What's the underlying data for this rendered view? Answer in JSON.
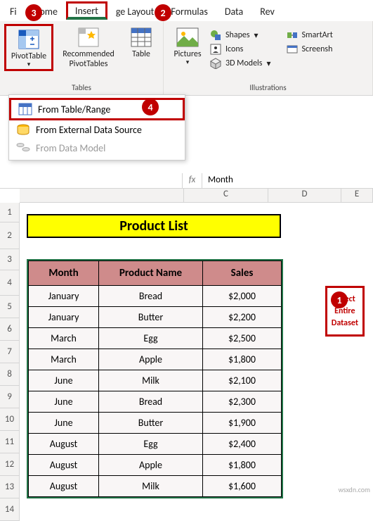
{
  "tabs": {
    "file": "Fi",
    "home": "Home",
    "insert": "Insert",
    "layout": "ge Layout",
    "formulas": "Formulas",
    "data": "Data",
    "review": "Rev"
  },
  "ribbon": {
    "pivot": "PivotTable",
    "recommended": "Recommended\nPivotTables",
    "table": "Table",
    "tables_group": "Tables",
    "pictures": "Pictures",
    "shapes": "Shapes",
    "icons": "Icons",
    "models": "3D Models",
    "illustrations_group": "Illustrations",
    "smartart": "SmartArt",
    "screenshot": "Screensh"
  },
  "dropdown": {
    "from_table": "From Table/Range",
    "from_external": "From External Data Source",
    "from_model": "From Data Model"
  },
  "formula": {
    "fx": "fx",
    "value": "Month"
  },
  "cols": [
    "C",
    "D",
    "E"
  ],
  "rows": [
    "1",
    "2",
    "3",
    "4",
    "5",
    "6",
    "7",
    "8",
    "9",
    "10",
    "11",
    "12",
    "13",
    "14"
  ],
  "title": "Product List",
  "headers": [
    "Month",
    "Product Name",
    "Sales"
  ],
  "data": [
    [
      "January",
      "Bread",
      "$2,000"
    ],
    [
      "January",
      "Butter",
      "$2,200"
    ],
    [
      "March",
      "Egg",
      "$2,500"
    ],
    [
      "March",
      "Apple",
      "$1,800"
    ],
    [
      "June",
      "Milk",
      "$2,100"
    ],
    [
      "June",
      "Bread",
      "$2,300"
    ],
    [
      "June",
      "Butter",
      "$1,900"
    ],
    [
      "August",
      "Egg",
      "$2,400"
    ],
    [
      "August",
      "Apple",
      "$1,800"
    ],
    [
      "August",
      "Milk",
      "$1,600"
    ]
  ],
  "callout": "Select\nEntire\nDataset",
  "badges": {
    "b1": "1",
    "b2": "2",
    "b3": "3",
    "b4": "4"
  },
  "watermark": "wsxdn.com"
}
